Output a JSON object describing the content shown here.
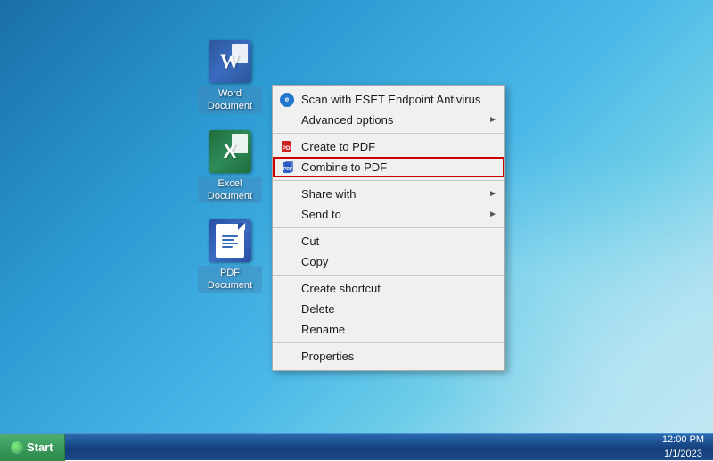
{
  "desktop": {
    "background": "windows7-blue"
  },
  "icons": [
    {
      "id": "word-document",
      "label": "Word\nDocument",
      "type": "word"
    },
    {
      "id": "excel-document",
      "label": "Excel\nDocument",
      "type": "excel"
    },
    {
      "id": "pdf-document",
      "label": "PDF\nDocument",
      "type": "pdf"
    }
  ],
  "contextMenu": {
    "items": [
      {
        "id": "scan-eset",
        "label": "Scan with ESET Endpoint Antivirus",
        "hasIcon": true,
        "iconType": "eset",
        "hasArrow": false,
        "separator": false
      },
      {
        "id": "advanced-options",
        "label": "Advanced options",
        "hasIcon": false,
        "hasArrow": true,
        "separator": false
      },
      {
        "id": "sep1",
        "separator": true
      },
      {
        "id": "create-to-pdf",
        "label": "Create to PDF",
        "hasIcon": true,
        "iconType": "pdf",
        "hasArrow": false,
        "separator": false
      },
      {
        "id": "combine-to-pdf",
        "label": "Combine to PDF",
        "hasIcon": true,
        "iconType": "pdf-combine",
        "hasArrow": false,
        "separator": false,
        "highlighted": true
      },
      {
        "id": "sep2",
        "separator": true
      },
      {
        "id": "share-with",
        "label": "Share with",
        "hasIcon": false,
        "hasArrow": true,
        "separator": false
      },
      {
        "id": "send-to",
        "label": "Send to",
        "hasIcon": false,
        "hasArrow": true,
        "separator": false
      },
      {
        "id": "sep3",
        "separator": true
      },
      {
        "id": "cut",
        "label": "Cut",
        "hasIcon": false,
        "hasArrow": false,
        "separator": false
      },
      {
        "id": "copy",
        "label": "Copy",
        "hasIcon": false,
        "hasArrow": false,
        "separator": false
      },
      {
        "id": "sep4",
        "separator": true
      },
      {
        "id": "create-shortcut",
        "label": "Create shortcut",
        "hasIcon": false,
        "hasArrow": false,
        "separator": false
      },
      {
        "id": "delete",
        "label": "Delete",
        "hasIcon": false,
        "hasArrow": false,
        "separator": false
      },
      {
        "id": "rename",
        "label": "Rename",
        "hasIcon": false,
        "hasArrow": false,
        "separator": false
      },
      {
        "id": "sep5",
        "separator": true
      },
      {
        "id": "properties",
        "label": "Properties",
        "hasIcon": false,
        "hasArrow": false,
        "separator": false
      }
    ]
  },
  "taskbar": {
    "startLabel": "Start",
    "time": "12:00 PM",
    "date": "1/1/2023"
  }
}
